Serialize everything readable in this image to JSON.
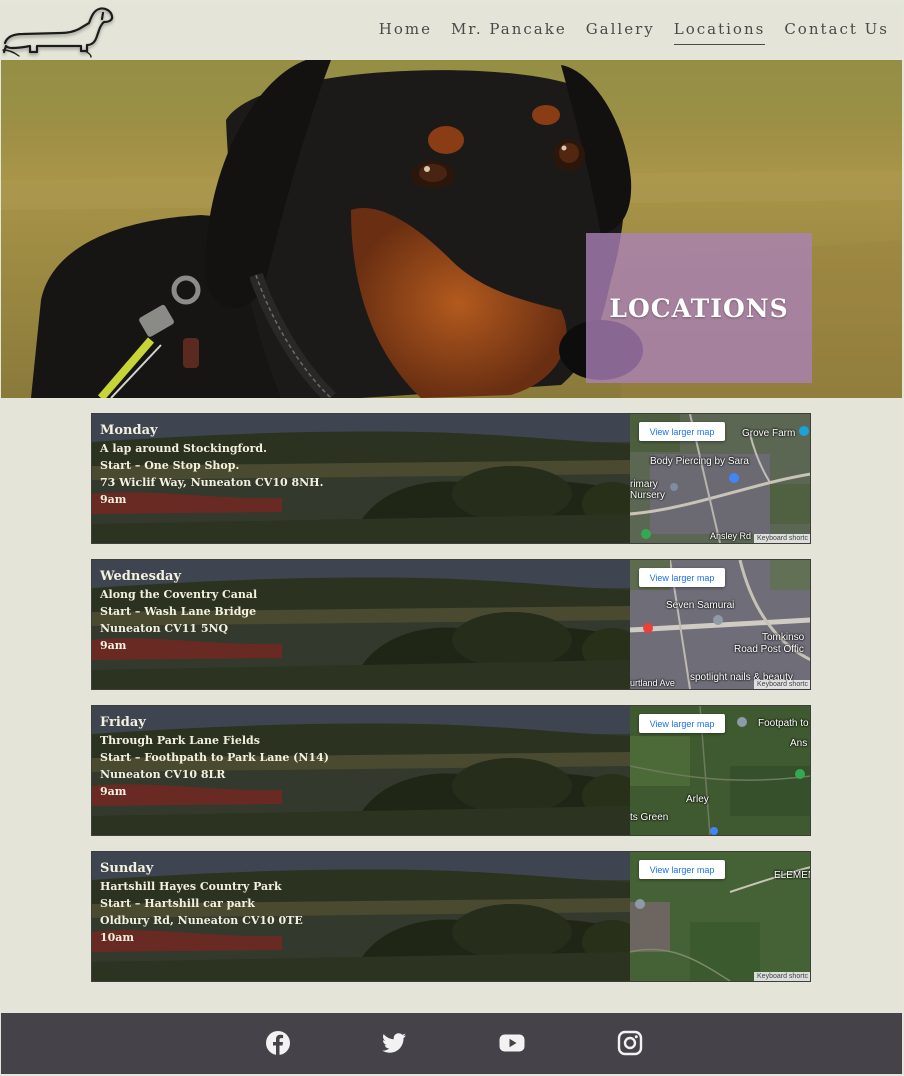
{
  "nav": {
    "items": [
      {
        "label": "Home",
        "active": false
      },
      {
        "label": "Mr. Pancake",
        "active": false
      },
      {
        "label": "Gallery",
        "active": false
      },
      {
        "label": "Locations",
        "active": true
      },
      {
        "label": "Contact Us",
        "active": false
      }
    ]
  },
  "logo": {
    "icon": "dachshund-logo-icon"
  },
  "hero": {
    "title": "LOCATIONS"
  },
  "walks": [
    {
      "day": "Monday",
      "lines": [
        "A lap around Stockingford.",
        "Start – One Stop Shop.",
        "73 Wiclif Way, Nuneaton CV10 8NH.",
        "9am"
      ],
      "map": {
        "button": "View larger map",
        "labels": [
          "Grove Farm",
          "Body Piercing by Sara",
          "rimary",
          "Nursery",
          "Ansley Rd"
        ],
        "footer": "Keyboard shortc"
      }
    },
    {
      "day": "Wednesday",
      "lines": [
        "Along the Coventry Canal",
        "Start – Wash Lane Bridge",
        "Nuneaton CV11 5NQ",
        "9am"
      ],
      "map": {
        "button": "View larger map",
        "labels": [
          "Seven Samurai",
          "Tomkinso",
          "Road Post Offic",
          "spotlight nails & beauty",
          "urtland Ave"
        ],
        "footer": "Keyboard shortc"
      }
    },
    {
      "day": "Friday",
      "lines": [
        "Through Park Lane Fields",
        "Start – Foothpath to Park Lane (N14)",
        "Nuneaton CV10 8LR",
        "9am"
      ],
      "map": {
        "button": "View larger map",
        "labels": [
          "Footpath to",
          "Ans",
          "Arley",
          "ts Green"
        ],
        "footer": ""
      }
    },
    {
      "day": "Sunday",
      "lines": [
        "Hartshill Hayes Country Park",
        "Start – Hartshill car park",
        "Oldbury Rd, Nuneaton CV10 0TE",
        "10am"
      ],
      "map": {
        "button": "View larger map",
        "labels": [
          "ELEMEN"
        ],
        "footer": "Keyboard shortc"
      }
    }
  ],
  "footer": {
    "social": [
      {
        "icon": "facebook-icon"
      },
      {
        "icon": "twitter-icon"
      },
      {
        "icon": "youtube-icon"
      },
      {
        "icon": "instagram-icon"
      }
    ]
  },
  "colors": {
    "background": "#e4e5d8",
    "footer": "#454349",
    "hero_box": "#aa82b9",
    "text_light": "#f4f0de"
  }
}
